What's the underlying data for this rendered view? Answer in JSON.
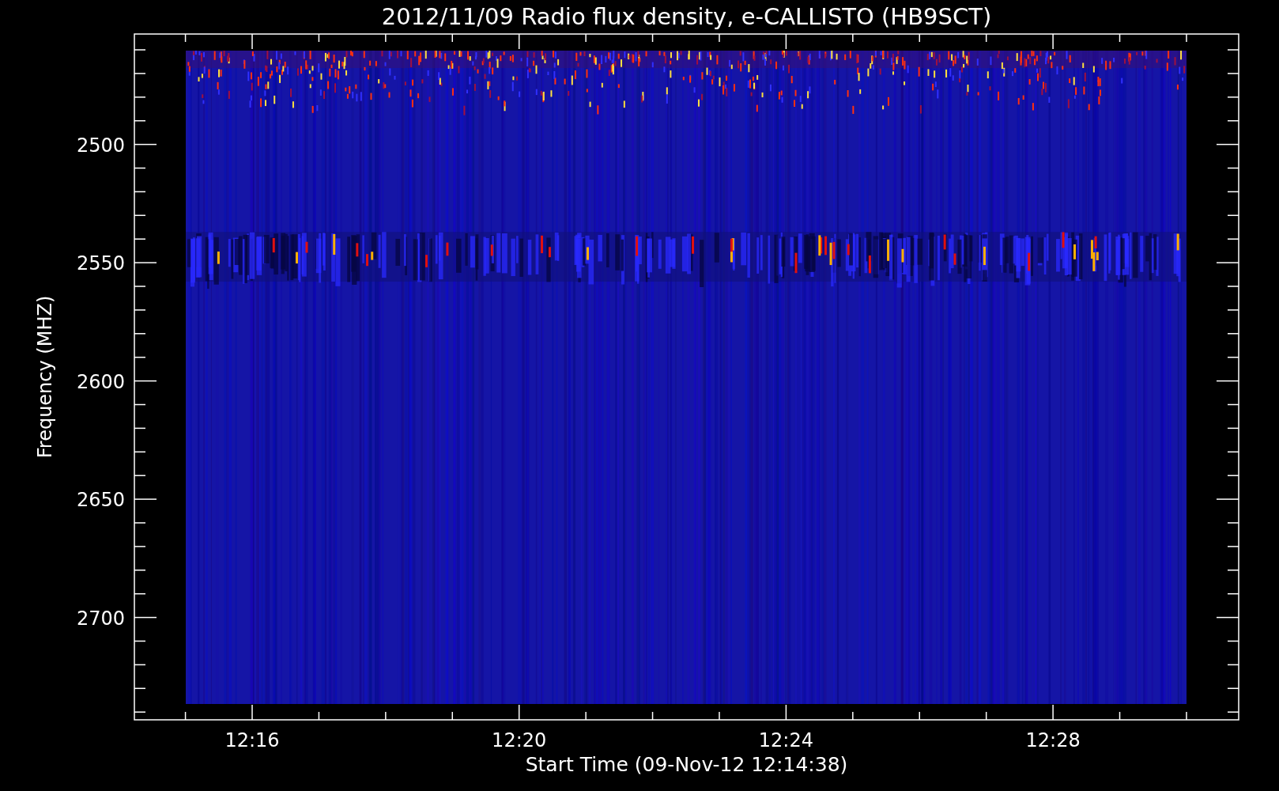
{
  "title": "2012/11/09  Radio flux density, e-CALLISTO (HB9SCT)",
  "y_axis": {
    "label": "Frequency (MHZ)",
    "ticks": [
      "2500",
      "2550",
      "2600",
      "2650",
      "2700"
    ]
  },
  "x_axis": {
    "label": "Start Time (09-Nov-12 12:14:38)",
    "ticks": [
      "12:16",
      "12:20",
      "12:24",
      "12:28"
    ]
  }
}
